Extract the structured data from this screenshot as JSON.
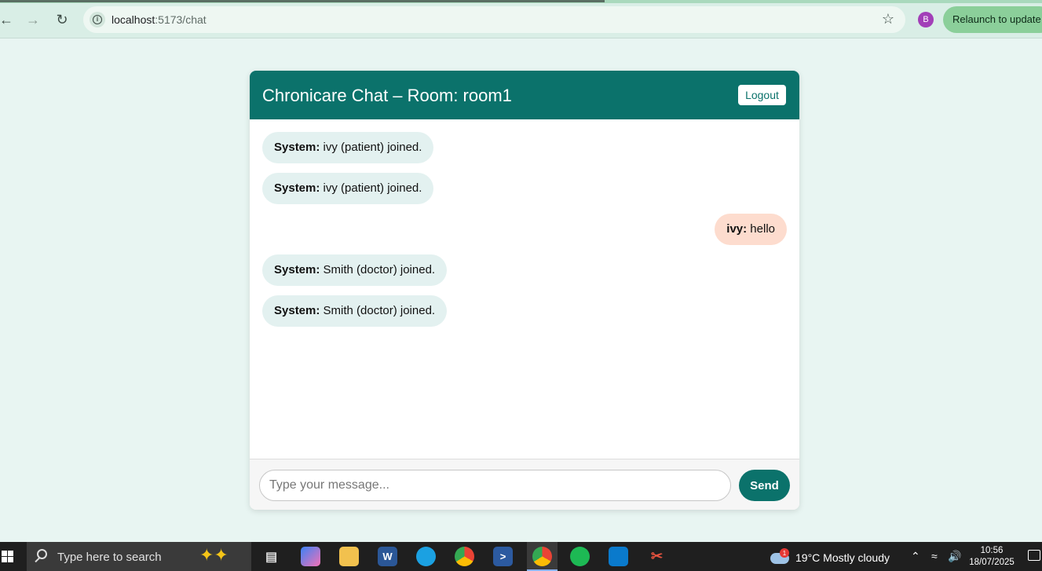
{
  "browser": {
    "url_host": "localhost",
    "url_path": ":5173/chat",
    "profile_initial": "B",
    "relaunch_label": "Relaunch to update"
  },
  "chat": {
    "title": "Chronicare Chat – Room: room1",
    "logout_label": "Logout",
    "messages": [
      {
        "sender": "System:",
        "text": " ivy (patient) joined.",
        "kind": "system"
      },
      {
        "sender": "System:",
        "text": " ivy (patient) joined.",
        "kind": "system"
      },
      {
        "sender": "ivy:",
        "text": " hello",
        "kind": "own"
      },
      {
        "sender": "System:",
        "text": " Smith (doctor) joined.",
        "kind": "system"
      },
      {
        "sender": "System:",
        "text": " Smith (doctor) joined.",
        "kind": "system"
      }
    ],
    "input_placeholder": "Type your message...",
    "send_label": "Send"
  },
  "taskbar": {
    "search_placeholder": "Type here to search",
    "apps": [
      "task-view-icon",
      "copilot-icon",
      "file-explorer-icon",
      "word-icon",
      "edge-icon",
      "chrome-icon",
      "powershell-icon",
      "chrome-profile-icon",
      "spotify-icon",
      "vscode-icon",
      "snipping-tool-icon"
    ],
    "weather_badge": "1",
    "weather": "19°C  Mostly cloudy",
    "time": "10:56",
    "date": "18/07/2025"
  },
  "colors": {
    "header": "#0b726b",
    "system_bubble": "#e3f1f0",
    "own_bubble": "#fddcce",
    "page_bg": "#e8f5f2"
  }
}
